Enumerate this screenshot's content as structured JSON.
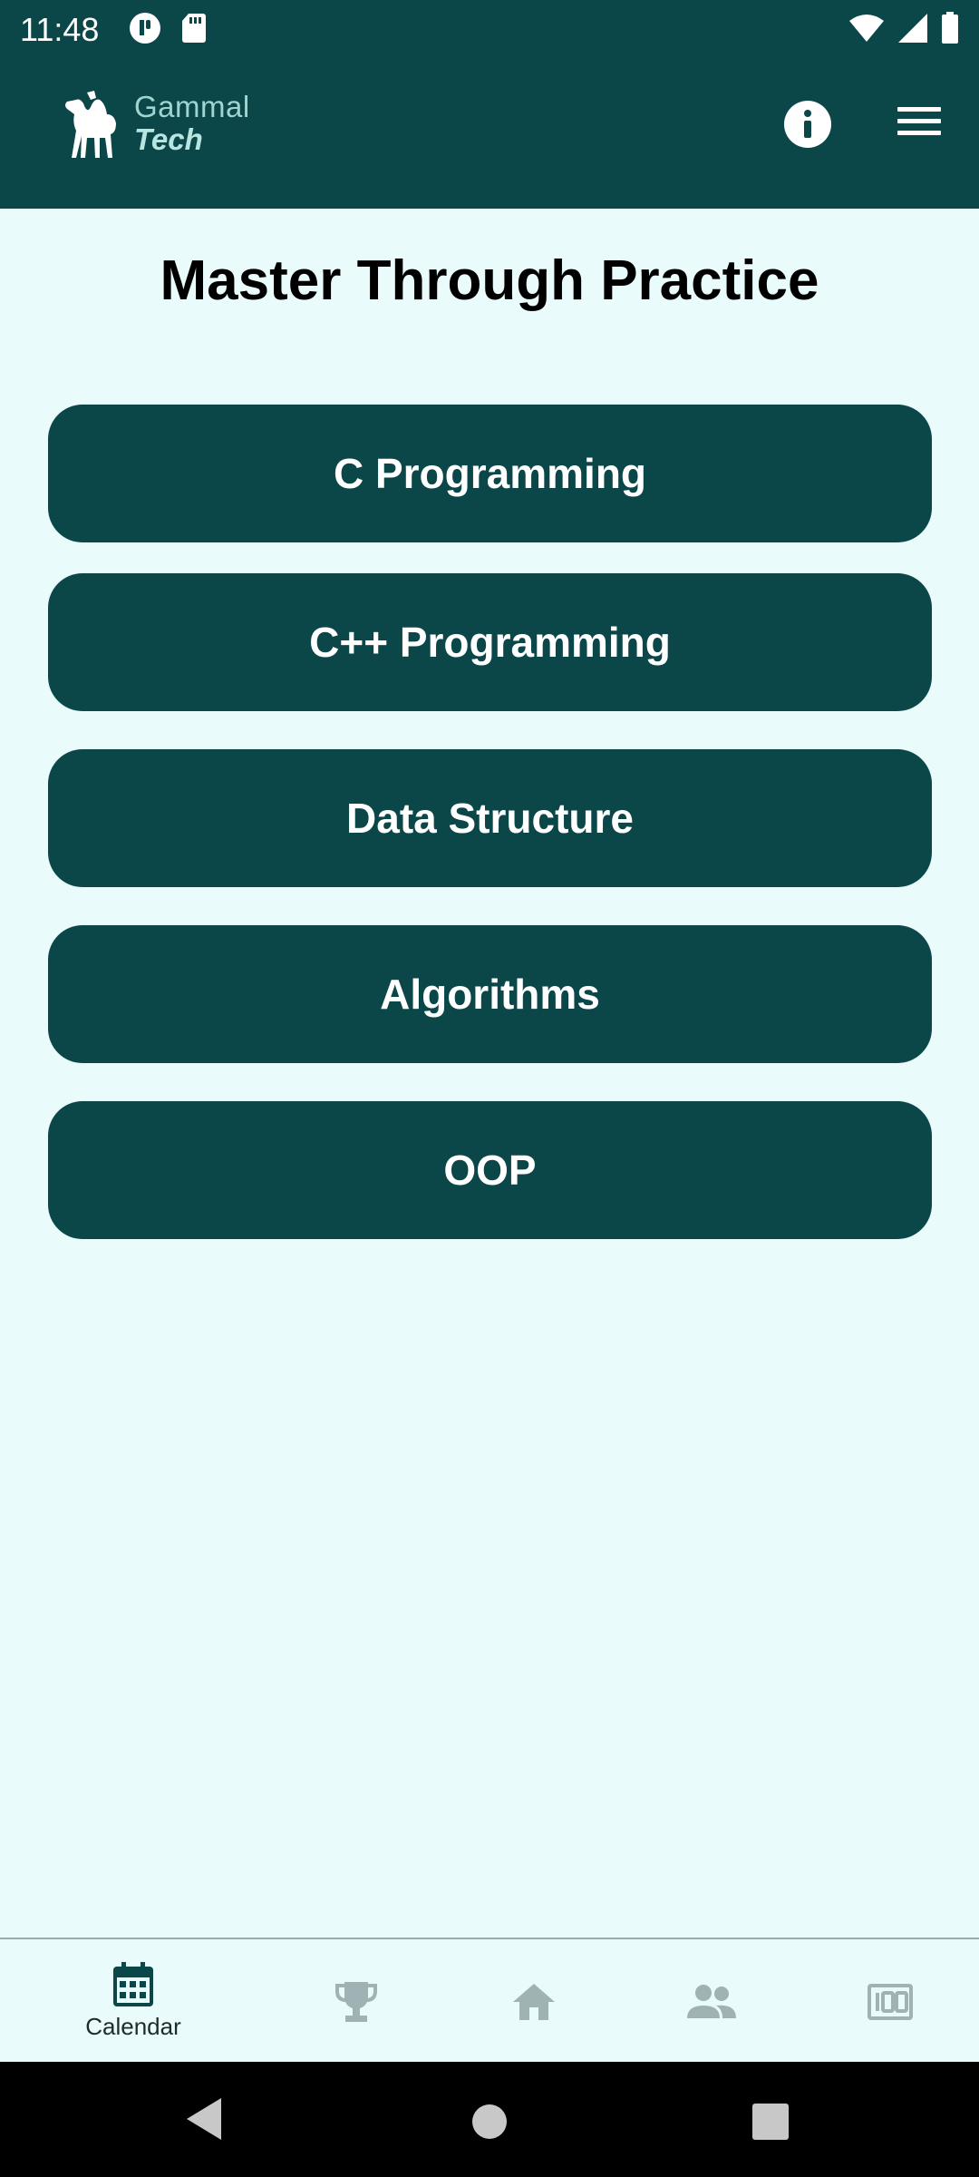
{
  "status_bar": {
    "time": "11:48"
  },
  "app": {
    "logo": {
      "line1": "Gammal",
      "line2": "Tech"
    },
    "title": "Master Through Practice"
  },
  "courses": [
    {
      "label": "C Programming"
    },
    {
      "label": "C++ Programming"
    },
    {
      "label": "Data Structure"
    },
    {
      "label": "Algorithms"
    },
    {
      "label": "OOP"
    }
  ],
  "bottom_nav": {
    "items": [
      {
        "label": "Calendar",
        "icon": "calendar-icon",
        "active": true
      },
      {
        "label": "",
        "icon": "trophy-icon",
        "active": false
      },
      {
        "label": "",
        "icon": "home-icon",
        "active": false
      },
      {
        "label": "",
        "icon": "people-icon",
        "active": false
      },
      {
        "label": "",
        "icon": "score-100-icon",
        "active": false
      }
    ]
  },
  "colors": {
    "primary": "#0b4649",
    "background": "#eafbfb",
    "inactive_icon": "#9fb2b4"
  }
}
